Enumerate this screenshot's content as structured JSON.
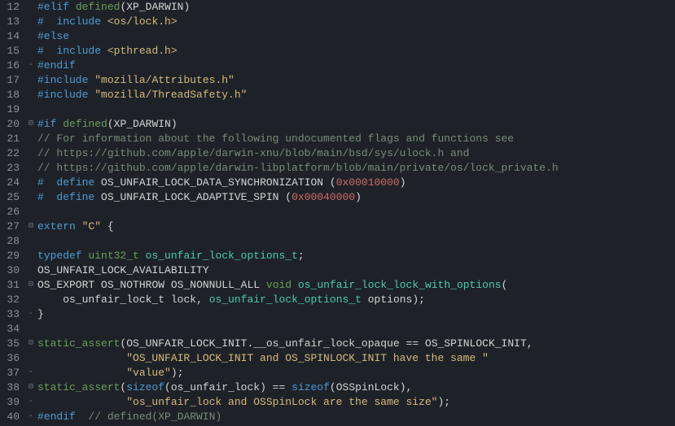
{
  "lines": [
    {
      "n": 12,
      "fold": "",
      "tokens": [
        {
          "t": "#elif",
          "c": "kw"
        },
        {
          "t": " ",
          "c": ""
        },
        {
          "t": "defined",
          "c": "green"
        },
        {
          "t": "(",
          "c": "punct"
        },
        {
          "t": "XP_DARWIN",
          "c": "macro"
        },
        {
          "t": ")",
          "c": "punct"
        }
      ]
    },
    {
      "n": 13,
      "fold": "",
      "tokens": [
        {
          "t": "#",
          "c": "kw"
        },
        {
          "t": "  ",
          "c": ""
        },
        {
          "t": "include",
          "c": "kw"
        },
        {
          "t": " ",
          "c": ""
        },
        {
          "t": "<os/lock.h>",
          "c": "yellow"
        }
      ]
    },
    {
      "n": 14,
      "fold": "",
      "tokens": [
        {
          "t": "#else",
          "c": "kw"
        }
      ]
    },
    {
      "n": 15,
      "fold": "",
      "tokens": [
        {
          "t": "#",
          "c": "kw"
        },
        {
          "t": "  ",
          "c": ""
        },
        {
          "t": "include",
          "c": "kw"
        },
        {
          "t": " ",
          "c": ""
        },
        {
          "t": "<pthread.h>",
          "c": "yellow"
        }
      ]
    },
    {
      "n": 16,
      "fold": "-",
      "tokens": [
        {
          "t": "#endif",
          "c": "kw"
        }
      ]
    },
    {
      "n": 17,
      "fold": "",
      "tokens": [
        {
          "t": "#include",
          "c": "kw"
        },
        {
          "t": " ",
          "c": ""
        },
        {
          "t": "\"mozilla/Attributes.h\"",
          "c": "yellow"
        }
      ]
    },
    {
      "n": 18,
      "fold": "",
      "tokens": [
        {
          "t": "#include",
          "c": "kw"
        },
        {
          "t": " ",
          "c": ""
        },
        {
          "t": "\"mozilla/ThreadSafety.h\"",
          "c": "yellow"
        }
      ]
    },
    {
      "n": 19,
      "fold": "",
      "tokens": []
    },
    {
      "n": 20,
      "fold": "⊟",
      "tokens": [
        {
          "t": "#if",
          "c": "kw"
        },
        {
          "t": " ",
          "c": ""
        },
        {
          "t": "defined",
          "c": "green"
        },
        {
          "t": "(",
          "c": "punct"
        },
        {
          "t": "XP_DARWIN",
          "c": "macro"
        },
        {
          "t": ")",
          "c": "punct"
        }
      ]
    },
    {
      "n": 21,
      "fold": "",
      "tokens": [
        {
          "t": "// For information about the following undocumented flags and functions see",
          "c": "commentg"
        }
      ]
    },
    {
      "n": 22,
      "fold": "",
      "tokens": [
        {
          "t": "// https://github.com/apple/darwin-xnu/blob/main/bsd/sys/ulock.h and",
          "c": "commentg"
        }
      ]
    },
    {
      "n": 23,
      "fold": "",
      "tokens": [
        {
          "t": "// https://github.com/apple/darwin-libplatform/blob/main/private/os/lock_private.h",
          "c": "commentg"
        }
      ]
    },
    {
      "n": 24,
      "fold": "",
      "tokens": [
        {
          "t": "#",
          "c": "kw"
        },
        {
          "t": "  ",
          "c": ""
        },
        {
          "t": "define",
          "c": "kw"
        },
        {
          "t": " ",
          "c": ""
        },
        {
          "t": "OS_UNFAIR_LOCK_DATA_SYNCHRONIZATION",
          "c": "macro"
        },
        {
          "t": " (",
          "c": "punct"
        },
        {
          "t": "0x00010000",
          "c": "numr"
        },
        {
          "t": ")",
          "c": "punct"
        }
      ]
    },
    {
      "n": 25,
      "fold": "",
      "tokens": [
        {
          "t": "#",
          "c": "kw"
        },
        {
          "t": "  ",
          "c": ""
        },
        {
          "t": "define",
          "c": "kw"
        },
        {
          "t": " ",
          "c": ""
        },
        {
          "t": "OS_UNFAIR_LOCK_ADAPTIVE_SPIN",
          "c": "macro"
        },
        {
          "t": " (",
          "c": "punct"
        },
        {
          "t": "0x00040000",
          "c": "numr"
        },
        {
          "t": ")",
          "c": "punct"
        }
      ]
    },
    {
      "n": 26,
      "fold": "",
      "tokens": []
    },
    {
      "n": 27,
      "fold": "⊟",
      "tokens": [
        {
          "t": "extern",
          "c": "kw"
        },
        {
          "t": " ",
          "c": ""
        },
        {
          "t": "\"C\"",
          "c": "yellow"
        },
        {
          "t": " {",
          "c": "punct"
        }
      ]
    },
    {
      "n": 28,
      "fold": "",
      "tokens": []
    },
    {
      "n": 29,
      "fold": "",
      "tokens": [
        {
          "t": "typedef",
          "c": "kw"
        },
        {
          "t": " ",
          "c": ""
        },
        {
          "t": "uint32_t",
          "c": "green"
        },
        {
          "t": " ",
          "c": ""
        },
        {
          "t": "os_unfair_lock_options_t",
          "c": "type"
        },
        {
          "t": ";",
          "c": "punct"
        }
      ]
    },
    {
      "n": 30,
      "fold": "",
      "tokens": [
        {
          "t": "OS_UNFAIR_LOCK_AVAILABILITY",
          "c": "macro"
        }
      ]
    },
    {
      "n": 31,
      "fold": "⊟",
      "tokens": [
        {
          "t": "OS_EXPORT",
          "c": "macro"
        },
        {
          "t": " ",
          "c": ""
        },
        {
          "t": "OS_NOTHROW",
          "c": "macro"
        },
        {
          "t": " ",
          "c": ""
        },
        {
          "t": "OS_NONNULL_ALL",
          "c": "macro"
        },
        {
          "t": " ",
          "c": ""
        },
        {
          "t": "void",
          "c": "green"
        },
        {
          "t": " ",
          "c": ""
        },
        {
          "t": "os_unfair_lock_lock_with_options",
          "c": "type"
        },
        {
          "t": "(",
          "c": "punct"
        }
      ]
    },
    {
      "n": 32,
      "fold": "",
      "tokens": [
        {
          "t": "    ",
          "c": ""
        },
        {
          "t": "os_unfair_lock_t",
          "c": "macro"
        },
        {
          "t": " ",
          "c": ""
        },
        {
          "t": "lock",
          "c": "ident"
        },
        {
          "t": ", ",
          "c": "punct"
        },
        {
          "t": "os_unfair_lock_options_t",
          "c": "type"
        },
        {
          "t": " ",
          "c": ""
        },
        {
          "t": "options",
          "c": "ident"
        },
        {
          "t": ");",
          "c": "punct"
        }
      ]
    },
    {
      "n": 33,
      "fold": "-",
      "tokens": [
        {
          "t": "}",
          "c": "punct"
        }
      ]
    },
    {
      "n": 34,
      "fold": "",
      "tokens": []
    },
    {
      "n": 35,
      "fold": "⊟",
      "tokens": [
        {
          "t": "static_assert",
          "c": "green"
        },
        {
          "t": "(",
          "c": "punct"
        },
        {
          "t": "OS_UNFAIR_LOCK_INIT",
          "c": "macro"
        },
        {
          "t": ".",
          "c": "punct"
        },
        {
          "t": "__os_unfair_lock_opaque",
          "c": "ident"
        },
        {
          "t": " == ",
          "c": "op"
        },
        {
          "t": "OS_SPINLOCK_INIT",
          "c": "macro"
        },
        {
          "t": ",",
          "c": "punct"
        }
      ]
    },
    {
      "n": 36,
      "fold": "",
      "tokens": [
        {
          "t": "              ",
          "c": ""
        },
        {
          "t": "\"OS_UNFAIR_LOCK_INIT and OS_SPINLOCK_INIT have the same \"",
          "c": "yellow"
        }
      ]
    },
    {
      "n": 37,
      "fold": "-",
      "tokens": [
        {
          "t": "              ",
          "c": ""
        },
        {
          "t": "\"value\"",
          "c": "yellow"
        },
        {
          "t": ");",
          "c": "punct"
        }
      ]
    },
    {
      "n": 38,
      "fold": "⊟",
      "tokens": [
        {
          "t": "static_assert",
          "c": "green"
        },
        {
          "t": "(",
          "c": "punct"
        },
        {
          "t": "sizeof",
          "c": "kw"
        },
        {
          "t": "(",
          "c": "punct"
        },
        {
          "t": "os_unfair_lock",
          "c": "ident"
        },
        {
          "t": ") == ",
          "c": "op"
        },
        {
          "t": "sizeof",
          "c": "kw"
        },
        {
          "t": "(",
          "c": "punct"
        },
        {
          "t": "OSSpinLock",
          "c": "ident"
        },
        {
          "t": "),",
          "c": "punct"
        }
      ]
    },
    {
      "n": 39,
      "fold": "-",
      "tokens": [
        {
          "t": "              ",
          "c": ""
        },
        {
          "t": "\"os_unfair_lock and OSSpinLock are the same size\"",
          "c": "yellow"
        },
        {
          "t": ");",
          "c": "punct"
        }
      ]
    },
    {
      "n": 40,
      "fold": "-",
      "tokens": [
        {
          "t": "#endif",
          "c": "kw"
        },
        {
          "t": "  ",
          "c": ""
        },
        {
          "t": "// defined(XP_DARWIN)",
          "c": "commentg"
        }
      ]
    }
  ]
}
